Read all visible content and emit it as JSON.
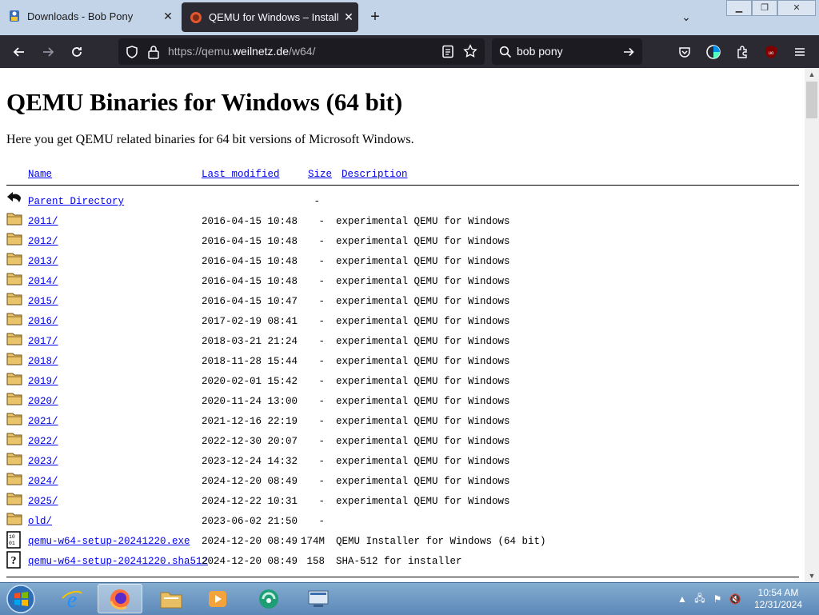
{
  "browser": {
    "tabs": [
      {
        "title": "Downloads - Bob Pony",
        "active": false
      },
      {
        "title": "QEMU for Windows – Installers",
        "active": true
      }
    ],
    "url_prefix": "https://qemu.",
    "url_host": "weilnetz.de",
    "url_path": "/w64/",
    "search_value": "bob pony",
    "accent_color": "#2b2a33",
    "icons": {
      "back": "arrow-left-icon",
      "forward": "arrow-right-icon",
      "reload": "reload-icon",
      "tracking": "shield-icon",
      "lock": "lock-icon",
      "reader": "reader-view-icon",
      "bookmark": "star-icon",
      "search": "search-icon",
      "go": "arrow-right-icon",
      "pocket": "pocket-icon",
      "account": "account-icon",
      "extensions": "puzzle-icon",
      "ublock": "ublock-icon",
      "menu": "hamburger-icon"
    }
  },
  "page": {
    "title": "QEMU Binaries for Windows (64 bit)",
    "intro": "Here you get QEMU related binaries for 64 bit versions of Microsoft Windows.",
    "columns": {
      "name": "Name",
      "last_modified": "Last modified",
      "size": "Size",
      "description": "Description"
    },
    "rows": [
      {
        "name": "Parent Directory",
        "date": "",
        "size": "-",
        "desc": "",
        "icon": "back-icon"
      },
      {
        "name": "2011/",
        "date": "2016-04-15 10:48",
        "size": "-",
        "desc": "experimental QEMU for Windows",
        "icon": "folder-icon"
      },
      {
        "name": "2012/",
        "date": "2016-04-15 10:48",
        "size": "-",
        "desc": "experimental QEMU for Windows",
        "icon": "folder-icon"
      },
      {
        "name": "2013/",
        "date": "2016-04-15 10:48",
        "size": "-",
        "desc": "experimental QEMU for Windows",
        "icon": "folder-icon"
      },
      {
        "name": "2014/",
        "date": "2016-04-15 10:48",
        "size": "-",
        "desc": "experimental QEMU for Windows",
        "icon": "folder-icon"
      },
      {
        "name": "2015/",
        "date": "2016-04-15 10:47",
        "size": "-",
        "desc": "experimental QEMU for Windows",
        "icon": "folder-icon"
      },
      {
        "name": "2016/",
        "date": "2017-02-19 08:41",
        "size": "-",
        "desc": "experimental QEMU for Windows",
        "icon": "folder-icon"
      },
      {
        "name": "2017/",
        "date": "2018-03-21 21:24",
        "size": "-",
        "desc": "experimental QEMU for Windows",
        "icon": "folder-icon"
      },
      {
        "name": "2018/",
        "date": "2018-11-28 15:44",
        "size": "-",
        "desc": "experimental QEMU for Windows",
        "icon": "folder-icon"
      },
      {
        "name": "2019/",
        "date": "2020-02-01 15:42",
        "size": "-",
        "desc": "experimental QEMU for Windows",
        "icon": "folder-icon"
      },
      {
        "name": "2020/",
        "date": "2020-11-24 13:00",
        "size": "-",
        "desc": "experimental QEMU for Windows",
        "icon": "folder-icon"
      },
      {
        "name": "2021/",
        "date": "2021-12-16 22:19",
        "size": "-",
        "desc": "experimental QEMU for Windows",
        "icon": "folder-icon"
      },
      {
        "name": "2022/",
        "date": "2022-12-30 20:07",
        "size": "-",
        "desc": "experimental QEMU for Windows",
        "icon": "folder-icon"
      },
      {
        "name": "2023/",
        "date": "2023-12-24 14:32",
        "size": "-",
        "desc": "experimental QEMU for Windows",
        "icon": "folder-icon"
      },
      {
        "name": "2024/",
        "date": "2024-12-20 08:49",
        "size": "-",
        "desc": "experimental QEMU for Windows",
        "icon": "folder-icon"
      },
      {
        "name": "2025/",
        "date": "2024-12-22 10:31",
        "size": "-",
        "desc": "experimental QEMU for Windows",
        "icon": "folder-icon"
      },
      {
        "name": "old/",
        "date": "2023-06-02 21:50",
        "size": "-",
        "desc": "",
        "icon": "folder-icon"
      },
      {
        "name": "qemu-w64-setup-20241220.exe",
        "date": "2024-12-20 08:49",
        "size": "174M",
        "desc": "QEMU Installer for Windows (64 bit)",
        "icon": "binary-file-icon"
      },
      {
        "name": "qemu-w64-setup-20241220.sha512",
        "date": "2024-12-20 08:49",
        "size": "158",
        "desc": "SHA-512 for installer",
        "icon": "unknown-file-icon"
      }
    ],
    "link_color": "#0000ee"
  },
  "taskbar": {
    "start_icon": "windows-start-icon",
    "apps": [
      {
        "name": "internet-explorer-icon",
        "active": false
      },
      {
        "name": "firefox-icon",
        "active": true
      },
      {
        "name": "file-explorer-icon",
        "active": false
      },
      {
        "name": "media-player-icon",
        "active": false
      },
      {
        "name": "app-green-icon",
        "active": false
      },
      {
        "name": "remote-desktop-icon",
        "active": false
      }
    ],
    "tray_icons": [
      "show-hidden-icons-icon",
      "network-icon",
      "action-center-flag-icon",
      "volume-muted-icon"
    ],
    "time": "10:54 AM",
    "date": "12/31/2024"
  }
}
